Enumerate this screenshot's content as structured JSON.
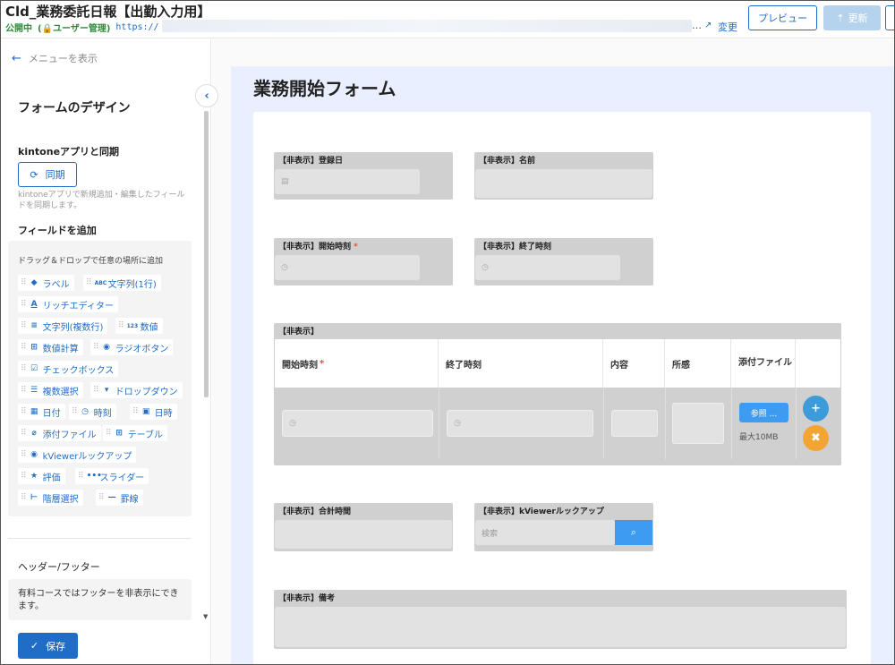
{
  "header": {
    "app_title": "Cld_業務委託日報【出勤入力用】",
    "status": "公開中",
    "user_mgmt": "(🔒ユーザー管理)",
    "url_prefix": "https://",
    "url_more": "…",
    "change_label": "変更",
    "preview_label": "プレビュー",
    "update_label": "更新"
  },
  "sidebar": {
    "menu_show": "メニューを表示",
    "title": "フォームのデザイン",
    "sync_section": "kintoneアプリと同期",
    "sync_button": "同期",
    "sync_note": "kintoneアプリで新規追加・編集したフィールドを同期します。",
    "add_section": "フィールドを追加",
    "drag_hint": "ドラッグ＆ドロップで任意の場所に追加",
    "fields": [
      {
        "label": "ラベル",
        "icon": "label-icon"
      },
      {
        "label": "文字列(1行)",
        "icon": "abc-icon"
      },
      {
        "label": "リッチエディター",
        "icon": "rich-text-icon"
      },
      {
        "label": "文字列(複数行)",
        "icon": "multiline-icon"
      },
      {
        "label": "数値",
        "icon": "number-icon"
      },
      {
        "label": "数値計算",
        "icon": "calc-icon"
      },
      {
        "label": "ラジオボタン",
        "icon": "radio-icon"
      },
      {
        "label": "チェックボックス",
        "icon": "checkbox-icon"
      },
      {
        "label": "複数選択",
        "icon": "list-icon"
      },
      {
        "label": "ドロップダウン",
        "icon": "dropdown-icon"
      },
      {
        "label": "日付",
        "icon": "calendar-icon"
      },
      {
        "label": "時刻",
        "icon": "clock-icon"
      },
      {
        "label": "日時",
        "icon": "datetime-icon"
      },
      {
        "label": "添付ファイル",
        "icon": "paperclip-icon"
      },
      {
        "label": "テーブル",
        "icon": "table-icon"
      },
      {
        "label": "kViewerルックアップ",
        "icon": "eye-icon"
      },
      {
        "label": "評価",
        "icon": "star-icon"
      },
      {
        "label": "スライダー",
        "icon": "slider-icon"
      },
      {
        "label": "階層選択",
        "icon": "hierarchy-icon"
      },
      {
        "label": "罫線",
        "icon": "line-icon"
      }
    ],
    "header_footer_section": "ヘッダー/フッター",
    "header_footer_note": "有料コースではフッターを非表示にできます。",
    "save_button": "保存"
  },
  "form": {
    "title": "業務開始フォーム",
    "fields": {
      "reg_date": "【非表示】登録日",
      "name": "【非表示】名前",
      "start_time": "【非表示】開始時刻",
      "end_time": "【非表示】終了時刻",
      "total_time": "【非表示】合計時間",
      "kviewer_lookup": "【非表示】kViewerルックアップ",
      "search_placeholder": "検索",
      "remarks": "【非表示】備考"
    },
    "table": {
      "label": "【非表示】",
      "columns": [
        "開始時刻",
        "終了時刻",
        "内容",
        "所感",
        "添付ファイル"
      ],
      "browse_label": "参照 ...",
      "max_size": "最大10MB"
    }
  }
}
